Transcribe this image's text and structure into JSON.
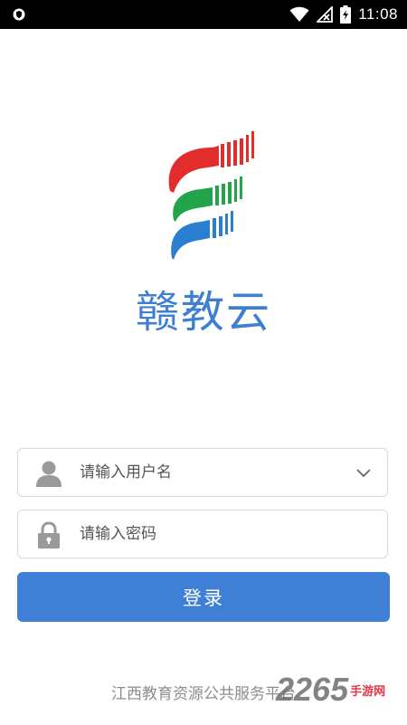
{
  "status_bar": {
    "time": "11:08",
    "icons": [
      "shield-icon",
      "wifi-icon",
      "no-signal-icon",
      "battery-charging-icon"
    ]
  },
  "app": {
    "name": "赣教云",
    "brand_colors": [
      "#e32c2c",
      "#22a44a",
      "#2b7fd1"
    ]
  },
  "login_form": {
    "username_placeholder": "请输入用户名",
    "password_placeholder": "请输入密码",
    "submit_label": "登录"
  },
  "footer": {
    "text": "江西教育资源公共服务平台"
  },
  "watermark": {
    "number": "2265",
    "site": "手游网"
  }
}
